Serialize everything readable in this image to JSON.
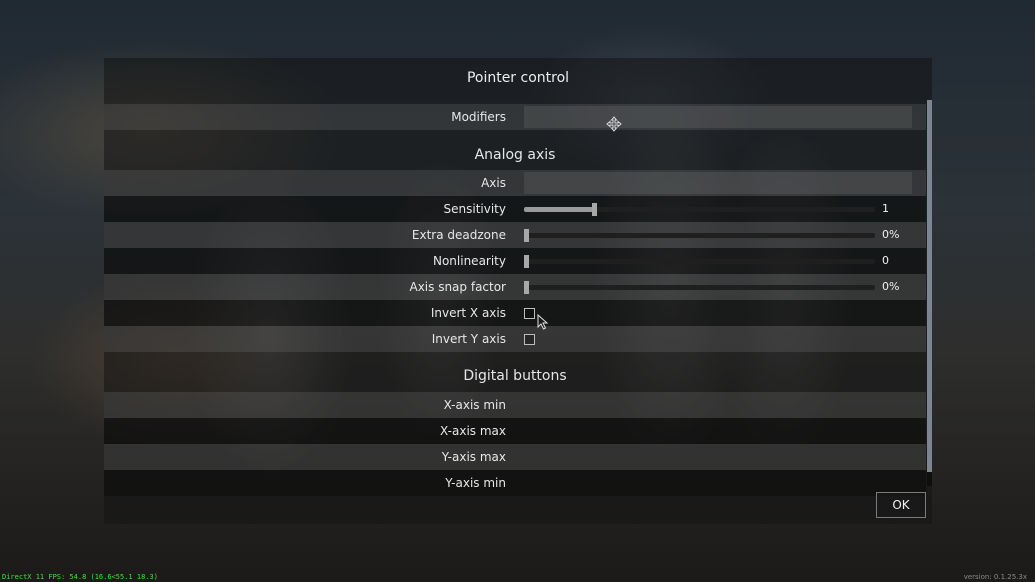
{
  "dialog": {
    "title": "Pointer control",
    "ok_label": "OK"
  },
  "modifiers": {
    "label": "Modifiers"
  },
  "analog_axis": {
    "section_title": "Analog axis",
    "axis_label": "Axis",
    "sensitivity": {
      "label": "Sensitivity",
      "value_text": "1",
      "level": 0.2
    },
    "extra_deadzone": {
      "label": "Extra deadzone",
      "value_text": "0%",
      "level": 0
    },
    "nonlinearity": {
      "label": "Nonlinearity",
      "value_text": "0",
      "level": 0
    },
    "axis_snap_factor": {
      "label": "Axis snap factor",
      "value_text": "0%",
      "level": 0
    },
    "invert_x": {
      "label": "Invert X axis",
      "checked": false
    },
    "invert_y": {
      "label": "Invert Y axis",
      "checked": false
    }
  },
  "digital_buttons": {
    "section_title": "Digital buttons",
    "items": [
      {
        "label": "X-axis min"
      },
      {
        "label": "X-axis max"
      },
      {
        "label": "Y-axis max"
      },
      {
        "label": "Y-axis min"
      }
    ]
  },
  "status": {
    "fps_text": "DirectX 11 FPS: 54.8 (16.6<55.1 18.3)",
    "version_text": "version: 0.1.25.3x"
  },
  "icons": {
    "axis_field": "move-arrows-icon",
    "pointer": "mouse-cursor-icon"
  },
  "colors": {
    "fps_text": "#3fe03f",
    "slider_fill": "#9a9a9a",
    "scrollbar_thumb": "#7d8592"
  }
}
